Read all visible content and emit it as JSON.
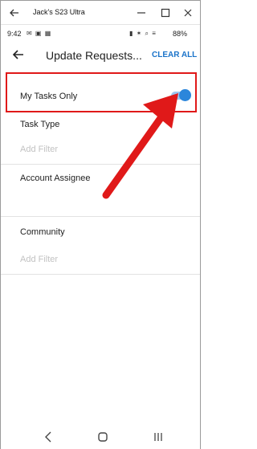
{
  "window": {
    "title": "Jack's S23 Ultra",
    "icons": [
      "back-arrow-icon",
      "minimize-icon",
      "maximize-icon",
      "close-icon"
    ]
  },
  "status_bar": {
    "time": "9:42",
    "left_icons": "✉ ▣ ▦",
    "right_icons": "▮ ✶ ⌕ ≡",
    "battery": "88%"
  },
  "header": {
    "title": "Update Requests...",
    "clear_all": "CLEAR ALL"
  },
  "filters": {
    "my_tasks_only": {
      "label": "My Tasks Only",
      "enabled": true
    },
    "task_type": {
      "label": "Task Type",
      "placeholder": "Add Filter"
    },
    "account_assignee": {
      "label": "Account Assignee"
    },
    "community": {
      "label": "Community",
      "placeholder": "Add Filter"
    }
  },
  "colors": {
    "accent": "#1a73c9",
    "toggle_on": "#2b86db",
    "highlight": "#e01919"
  },
  "nav_bar": {
    "icons": [
      "nav-back-icon",
      "nav-home-icon",
      "nav-recents-icon"
    ]
  }
}
